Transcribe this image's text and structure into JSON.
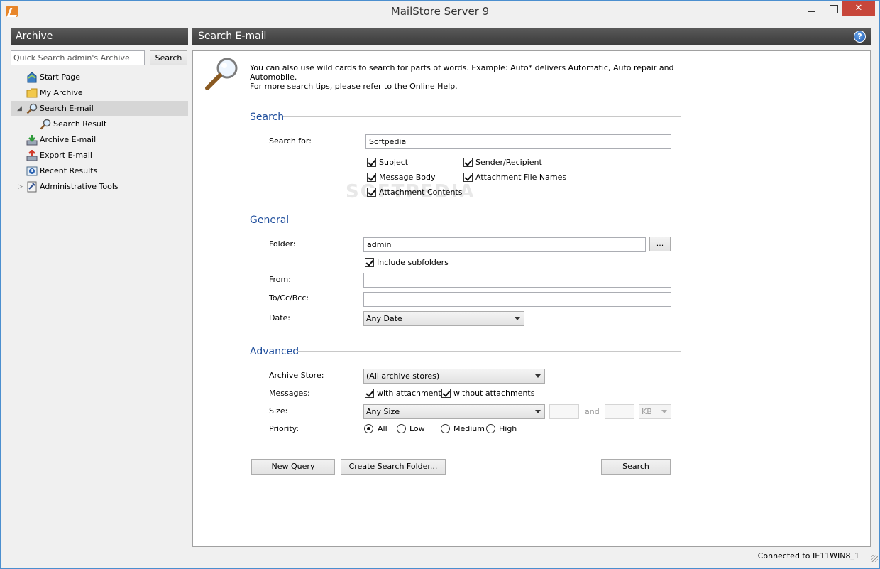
{
  "window": {
    "title": "MailStore Server 9",
    "close_glyph": "✕"
  },
  "left_panel": {
    "header": "Archive",
    "quick_search_placeholder": "Quick Search admin's Archive",
    "quick_search_button": "Search",
    "tree": [
      {
        "label": "Start Page",
        "icon": "start-page-icon"
      },
      {
        "label": "My Archive",
        "icon": "folder-icon"
      },
      {
        "label": "Search E-mail",
        "icon": "magnifier-icon",
        "expanded": true,
        "selected": true
      },
      {
        "label": "Search Result",
        "icon": "magnifier-icon"
      },
      {
        "label": "Archive E-mail",
        "icon": "archive-email-icon"
      },
      {
        "label": "Export E-mail",
        "icon": "export-email-icon"
      },
      {
        "label": "Recent Results",
        "icon": "recent-results-icon"
      },
      {
        "label": "Administrative Tools",
        "icon": "admin-tools-icon",
        "expanded": false
      }
    ]
  },
  "main": {
    "header": "Search E-mail",
    "help_glyph": "?",
    "tip_line1": "You can also use wild cards to search for parts of words. Example: Auto* delivers Automatic, Auto repair and Automobile.",
    "tip_line2": "For more search tips, please refer to the Online Help.",
    "watermark": "SOFTPEDIA",
    "search_section": {
      "title": "Search",
      "search_for_label": "Search for:",
      "search_for_value": "Softpedia",
      "options": {
        "subject": "Subject",
        "sender_recipient": "Sender/Recipient",
        "message_body": "Message Body",
        "attachment_file_names": "Attachment File Names",
        "attachment_contents": "Attachment Contents"
      }
    },
    "general_section": {
      "title": "General",
      "folder_label": "Folder:",
      "folder_value": "admin",
      "browse_button": "...",
      "include_subfolders": "Include subfolders",
      "from_label": "From:",
      "from_value": "",
      "tocc_label": "To/Cc/Bcc:",
      "tocc_value": "",
      "date_label": "Date:",
      "date_value": "Any Date"
    },
    "advanced_section": {
      "title": "Advanced",
      "archive_store_label": "Archive Store:",
      "archive_store_value": "(All archive stores)",
      "messages_label": "Messages:",
      "with_attachments": "with attachments",
      "without_attachments": "without attachments",
      "size_label": "Size:",
      "size_value": "Any Size",
      "and_label": "and",
      "size_unit": "KB",
      "priority_label": "Priority:",
      "priority_all": "All",
      "priority_low": "Low",
      "priority_medium": "Medium",
      "priority_high": "High"
    },
    "buttons": {
      "new_query": "New Query",
      "create_search_folder": "Create Search Folder...",
      "search": "Search"
    }
  },
  "status_bar": {
    "text": "Connected to IE11WIN8_1"
  }
}
